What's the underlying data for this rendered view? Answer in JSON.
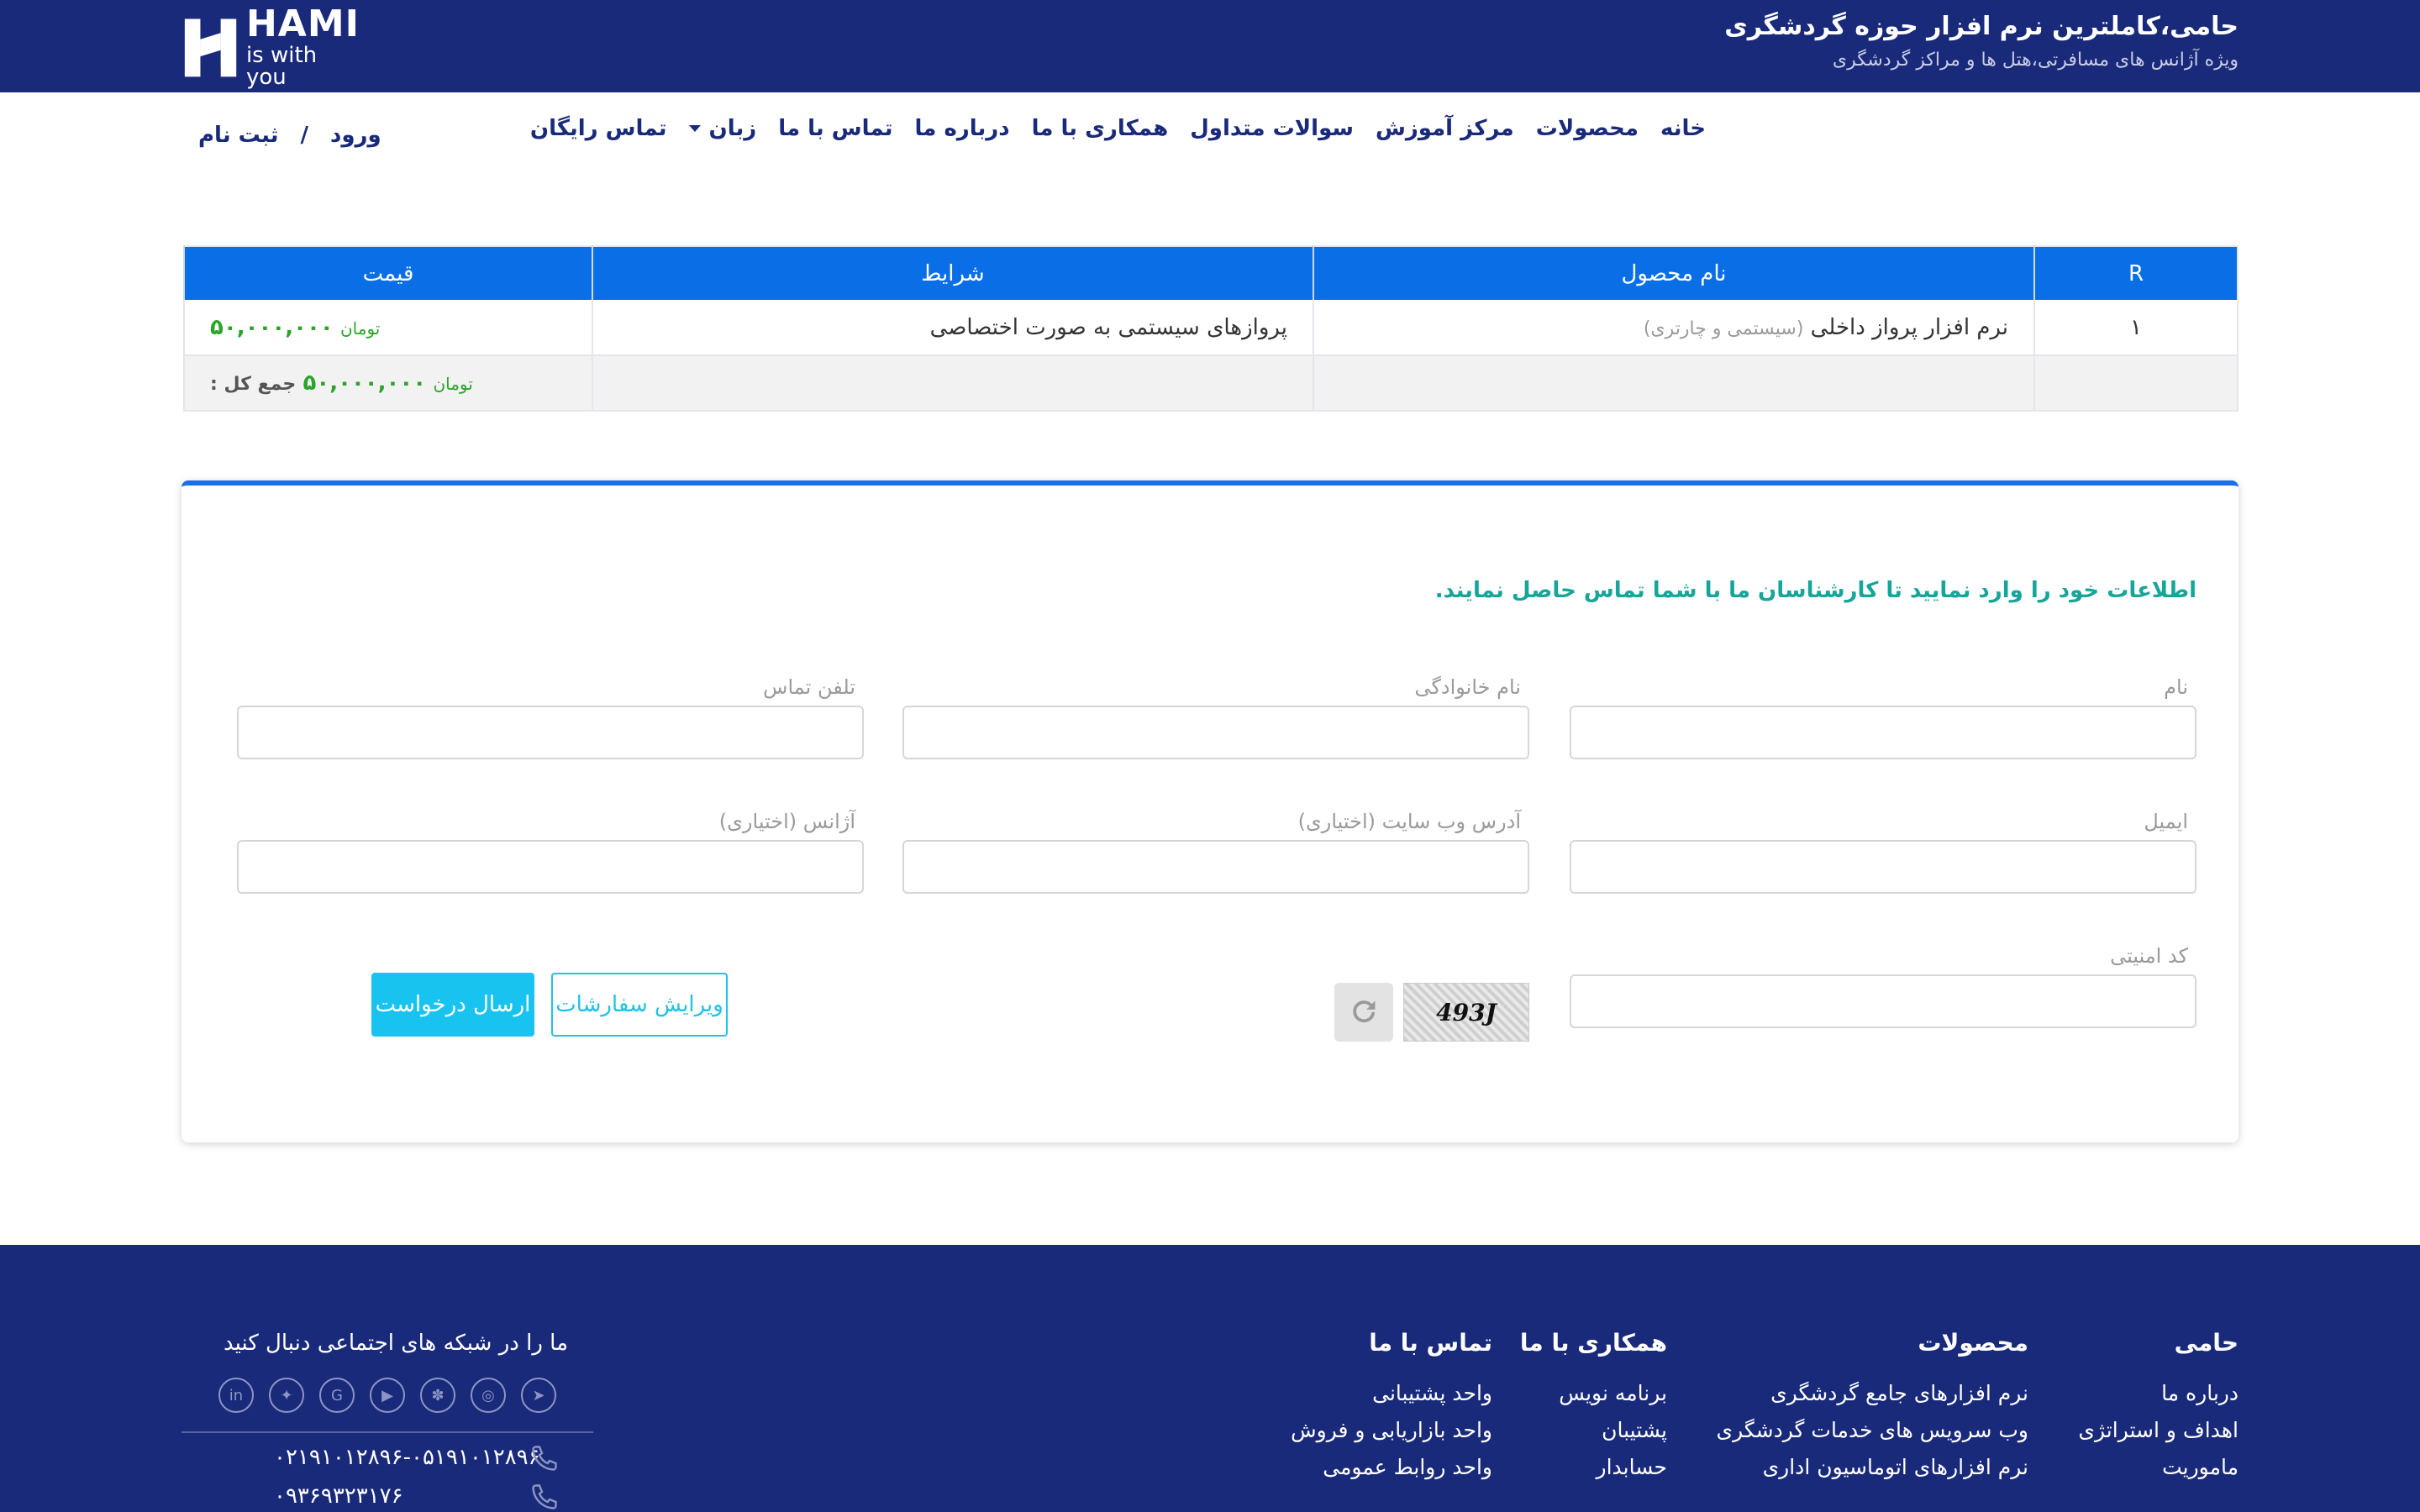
{
  "header": {
    "logo_word": "HAMI",
    "logo_tagline": "is with you",
    "title": "حامی،کاملترین نرم افزار حوزه گردشگری",
    "subtitle": "ویژه آژانس های مسافرتی،هتل ها و مراکز گردشگری"
  },
  "nav": {
    "items": [
      "خانه",
      "محصولات",
      "مرکز آموزش",
      "سوالات متداول",
      "همکاری با ما",
      "درباره ما",
      "تماس با ما",
      "زبان",
      "تماس رایگان"
    ],
    "login": "ورود",
    "separator": "/",
    "register": "ثبت نام"
  },
  "cart": {
    "headers": [
      "R",
      "نام محصول",
      "شرایط",
      "قیمت"
    ],
    "rows": [
      {
        "index": "۱",
        "product": "نرم افزار پرواز داخلی",
        "product_note": "(سیستمی و چارتری)",
        "condition": "پروازهای سیستمی به صورت اختصاصی",
        "price": "۵۰,۰۰۰,۰۰۰",
        "currency": "تومان"
      }
    ],
    "total_label": "جمع کل :",
    "total_price": "۵۰,۰۰۰,۰۰۰",
    "total_currency": "تومان"
  },
  "form": {
    "intro": "اطلاعات خود را وارد نمایید تا کارشناسان ما با شما تماس حاصل نمایند.",
    "first_name": "نام",
    "last_name": "نام خانوادگی",
    "phone": "تلفن تماس",
    "email": "ایمیل",
    "website": "آدرس وب سایت (اختیاری)",
    "agency": "آژانس (اختیاری)",
    "security_code": "کد امنیتی",
    "captcha_text": "493J",
    "edit_button": "ویرایش سفارشات",
    "send_button": "ارسال درخواست"
  },
  "footer": {
    "col_hami": {
      "title": "حامی",
      "items": [
        "درباره ما",
        "اهداف و استراتژی",
        "ماموریت"
      ]
    },
    "col_products": {
      "title": "محصولات",
      "items": [
        "نرم افزارهای جامع گردشگری",
        "وب سرویس های خدمات گردشگری",
        "نرم افزارهای اتوماسیون اداری"
      ]
    },
    "col_coop": {
      "title": "همکاری با ما",
      "items": [
        "برنامه نویس",
        "پشتیبان",
        "حسابدار"
      ]
    },
    "col_contact": {
      "title": "تماس با ما",
      "items": [
        "واحد پشتیبانی",
        "واحد بازاریابی و فروش",
        "واحد روابط عمومی"
      ]
    },
    "social_title": "ما را در شبکه های اجتماعی دنبال کنید",
    "social_icons": [
      "linkedin-icon",
      "twitter-icon",
      "google-icon",
      "youtube-icon",
      "aparat-icon",
      "instagram-icon",
      "telegram-icon"
    ],
    "phone1": "۰۲۱۹۱۰۱۲۸۹۶-۰۵۱۹۱۰۱۲۸۹۶",
    "phone2": "۰۹۳۶۹۳۲۳۱۷۶"
  },
  "colors": {
    "brand_navy": "#1a2a7a",
    "table_header": "#0a6fe6",
    "price_green": "#2aa52a",
    "intro_teal": "#17a59a",
    "button_cyan": "#19c3ef"
  }
}
